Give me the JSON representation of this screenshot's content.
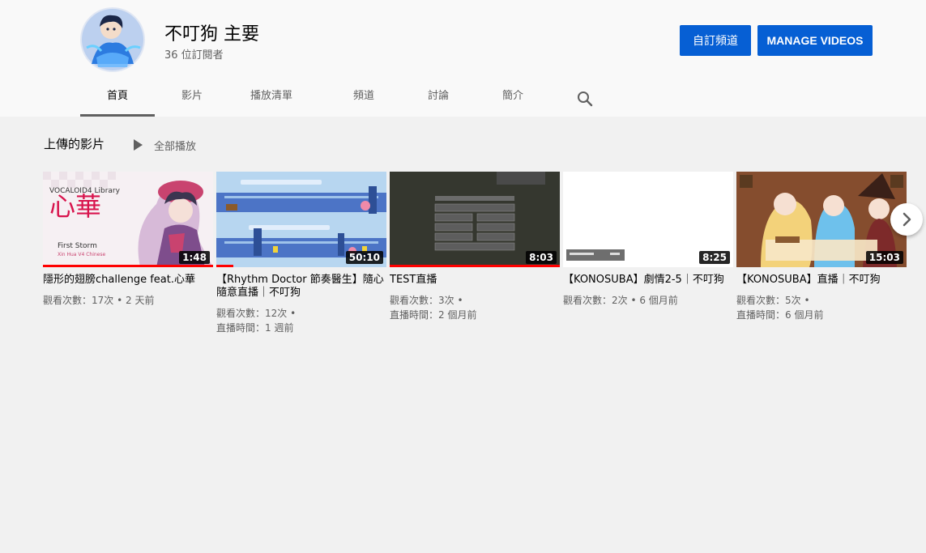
{
  "channel": {
    "name": "不叮狗 主要",
    "subscribers": "36 位訂閱者",
    "customize_label": "自訂頻道",
    "manage_label": "MANAGE VIDEOS"
  },
  "tabs": [
    {
      "label": "首頁"
    },
    {
      "label": "影片"
    },
    {
      "label": "播放清單"
    },
    {
      "label": "頻道"
    },
    {
      "label": "討論"
    },
    {
      "label": "簡介"
    }
  ],
  "shelf": {
    "title": "上傳的影片",
    "play_all": "全部播放"
  },
  "thumb_text": {
    "vocaloid": "VOCALOID4 Library",
    "hanzi": "心華",
    "first_storm": "First Storm",
    "caption": "Xin Hua V4 Chinese"
  },
  "videos": [
    {
      "title": "隱形的翅膀challenge feat.心華",
      "views": "觀看次數：17次",
      "age": "2 天前",
      "duration": "1:48",
      "progress": 1.0
    },
    {
      "title": "【Rhythm Doctor 節奏醫生】隨心隨意直播｜不叮狗",
      "views": "觀看次數：12次",
      "age": "直播時間：1 週前",
      "duration": "50:10",
      "progress": 0.1
    },
    {
      "title": "TEST直播",
      "views": "觀看次數：3次",
      "age": "直播時間：2 個月前",
      "duration": "8:03",
      "progress": 1.0
    },
    {
      "title": "【KONOSUBA】劇情2-5｜不叮狗",
      "views": "觀看次數：2次",
      "age": "6 個月前",
      "duration": "8:25",
      "progress": 0
    },
    {
      "title": "【KONOSUBA】直播｜不叮狗",
      "views": "觀看次數：5次",
      "age": "直播時間：6 個月前",
      "duration": "15:03",
      "progress": 0
    }
  ],
  "icons": {
    "search": "search-icon",
    "next": "chevron-right-icon",
    "play_all": "play-icon"
  },
  "colors": {
    "accent": "#065fd4",
    "progress": "#ff0000"
  }
}
